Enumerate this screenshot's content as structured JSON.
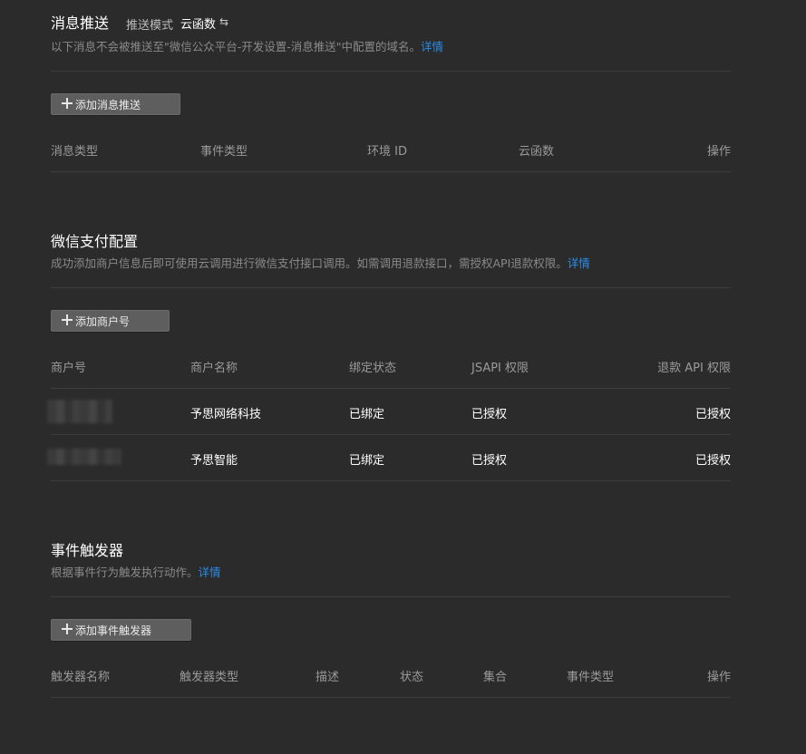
{
  "push": {
    "title": "消息推送",
    "mode_label": "推送模式",
    "mode_value": "云函数",
    "desc": "以下消息不会被推送至\"微信公众平台-开发设置-消息推送\"中配置的域名。",
    "detail_link": "详情",
    "add_button": "添加消息推送",
    "columns": [
      "消息类型",
      "事件类型",
      "环境 ID",
      "云函数",
      "操作"
    ]
  },
  "pay": {
    "title": "微信支付配置",
    "desc": "成功添加商户信息后即可使用云调用进行微信支付接口调用。如需调用退款接口，需授权API退款权限。",
    "detail_link": "详情",
    "add_button": "添加商户号",
    "columns": [
      "商户号",
      "商户名称",
      "绑定状态",
      "JSAPI 权限",
      "退款 API 权限"
    ],
    "rows": [
      {
        "name": "予思网络科技",
        "bind": "已绑定",
        "jsapi": "已授权",
        "refund": "已授权"
      },
      {
        "name": "予思智能",
        "bind": "已绑定",
        "jsapi": "已授权",
        "refund": "已授权"
      }
    ]
  },
  "trigger": {
    "title": "事件触发器",
    "desc": "根据事件行为触发执行动作。",
    "detail_link": "详情",
    "add_button": "添加事件触发器",
    "columns": [
      "触发器名称",
      "触发器类型",
      "描述",
      "状态",
      "集合",
      "事件类型",
      "操作"
    ]
  },
  "colors": {
    "background": "#2b2b2b",
    "link": "#2b8be8",
    "button": "#5e5e5e"
  }
}
